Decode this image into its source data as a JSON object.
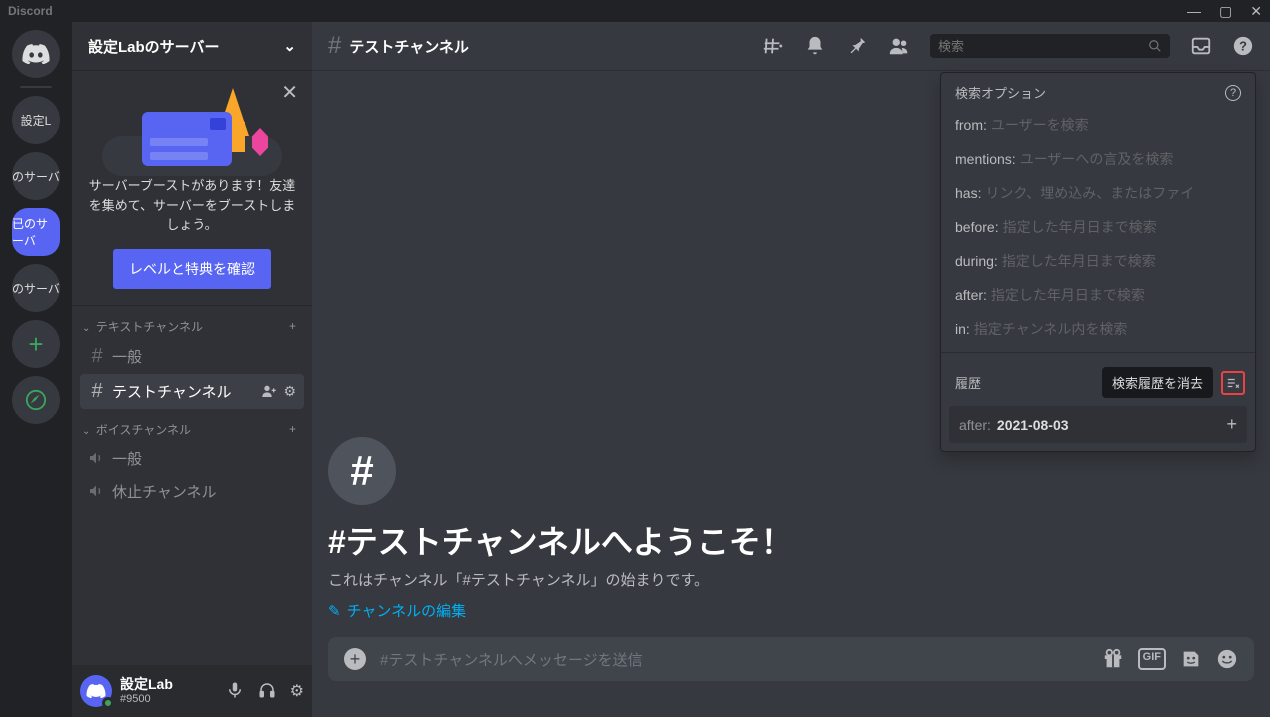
{
  "app_name": "Discord",
  "guilds": {
    "labels": [
      "設定L",
      "のサーバ",
      "已のサーバ",
      "のサーバ"
    ]
  },
  "server": {
    "name": "設定Labのサーバー"
  },
  "boost": {
    "text": "サーバーブーストがあります！友達を集めて、サーバーをブーストしましょう。",
    "button": "レベルと特典を確認"
  },
  "channels": {
    "text_header": "テキストチャンネル",
    "voice_header": "ボイスチャンネル",
    "text": [
      {
        "name": "一般"
      },
      {
        "name": "テストチャンネル"
      }
    ],
    "voice": [
      {
        "name": "一般"
      },
      {
        "name": "休止チャンネル"
      }
    ]
  },
  "user": {
    "name": "設定Lab",
    "tag": "#9500"
  },
  "chat": {
    "title": "テストチャンネル",
    "welcome_title": "#テストチャンネルへようこそ！",
    "welcome_sub": "これはチャンネル「#テストチャンネル」の始まりです。",
    "edit": "チャンネルの編集",
    "placeholder": "#テストチャンネルへメッセージを送信",
    "gif": "GIF"
  },
  "search": {
    "placeholder": "検索",
    "options_title": "検索オプション",
    "filters": [
      {
        "k": "from:",
        "h": "ユーザーを検索"
      },
      {
        "k": "mentions:",
        "h": "ユーザーへの言及を検索"
      },
      {
        "k": "has:",
        "h": "リンク、埋め込み、またはファイ"
      },
      {
        "k": "before:",
        "h": "指定した年月日まで検索"
      },
      {
        "k": "during:",
        "h": "指定した年月日まで検索"
      },
      {
        "k": "after:",
        "h": "指定した年月日まで検索"
      },
      {
        "k": "in:",
        "h": "指定チャンネル内を検索"
      }
    ],
    "history_label": "履歴",
    "clear_tooltip": "検索履歴を消去",
    "history": {
      "k": "after:",
      "v": "2021-08-03"
    }
  }
}
